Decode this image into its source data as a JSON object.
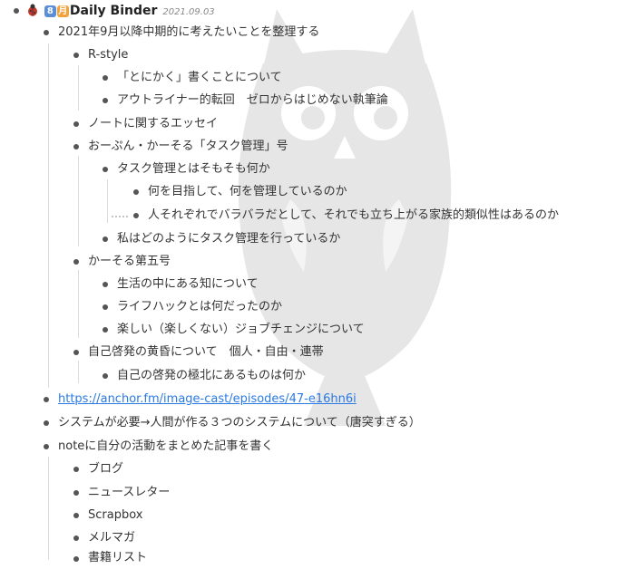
{
  "header": {
    "badge_number": "8",
    "badge_calendar": "月",
    "title": "Daily Binder",
    "date": "2021.09.03"
  },
  "items": [
    {
      "level": 1,
      "text": "2021年9月以降中期的に考えたいことを整理する"
    },
    {
      "level": 2,
      "text": "R-style"
    },
    {
      "level": 3,
      "text": "「とにかく」書くことについて"
    },
    {
      "level": 3,
      "text": "アウトライナー的転回　ゼロからはじめない執筆論"
    },
    {
      "level": 2,
      "text": "ノートに関するエッセイ"
    },
    {
      "level": 2,
      "text": "おーぷん・かーそる「タスク管理」号"
    },
    {
      "level": 3,
      "text": "タスク管理とはそもそも何か"
    },
    {
      "level": 4,
      "text": "何を目指して、何を管理しているのか"
    },
    {
      "level": 4,
      "text": "人それぞれでバラバラだとして、それでも立ち上がる家族的類似性はあるのか",
      "dragging": true
    },
    {
      "level": 3,
      "text": "私はどのようにタスク管理を行っているか"
    },
    {
      "level": 2,
      "text": "かーそる第五号"
    },
    {
      "level": 3,
      "text": "生活の中にある知について"
    },
    {
      "level": 3,
      "text": "ライフハックとは何だったのか"
    },
    {
      "level": 3,
      "text": "楽しい（楽しくない）ジョブチェンジについて"
    },
    {
      "level": 2,
      "text": "自己啓発の黄昏について　個人・自由・連帯"
    },
    {
      "level": 3,
      "text": "自己の啓発の極北にあるものは何か"
    },
    {
      "level": 1,
      "text": "https://anchor.fm/image-cast/episodes/47-e16hn6i",
      "link": true
    },
    {
      "level": 1,
      "text": "システムが必要→人間が作る３つのシステムについて（唐突すぎる）"
    },
    {
      "level": 1,
      "text": "noteに自分の活動をまとめた記事を書く"
    },
    {
      "level": 2,
      "text": "ブログ"
    },
    {
      "level": 2,
      "text": "ニュースレター"
    },
    {
      "level": 2,
      "text": "Scrapbox"
    },
    {
      "level": 2,
      "text": "メルマガ"
    },
    {
      "level": 2,
      "text": "書籍リスト"
    }
  ],
  "colors": {
    "text": "#333333",
    "bullet": "#555555",
    "link": "#2a7ae2",
    "owl_watermark": "#e6e6e6",
    "guide_line": "#dcdcdc"
  },
  "icons": {
    "header_emoji": "ladybug-icon",
    "watermark": "owl-watermark"
  }
}
